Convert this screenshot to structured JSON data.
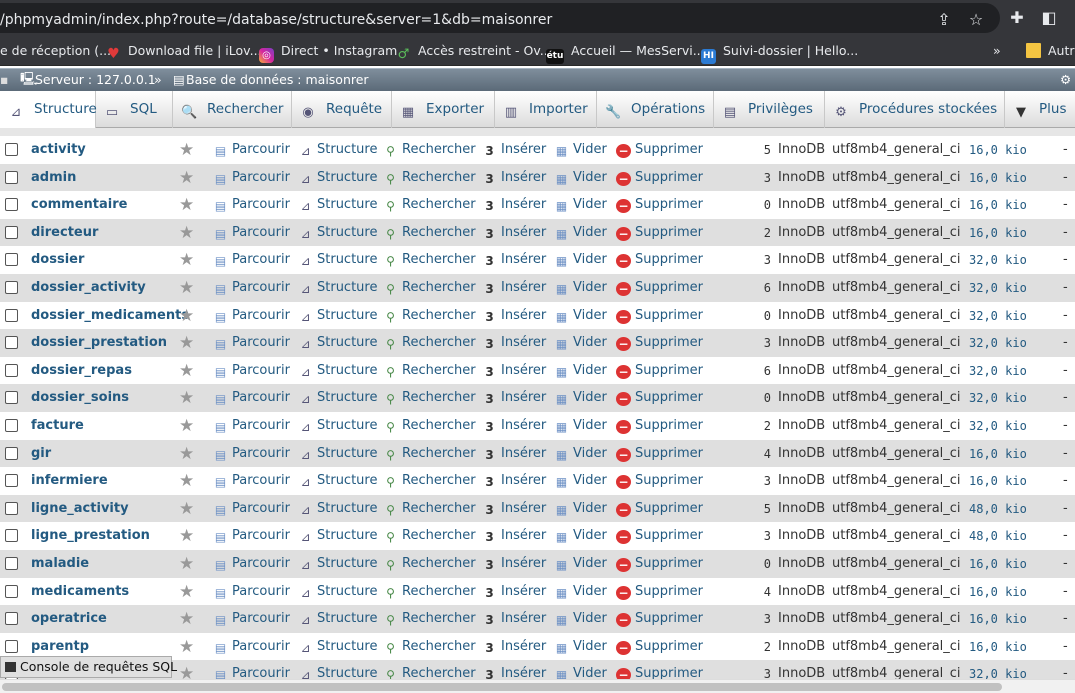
{
  "browser": {
    "url": "/phpmyadmin/index.php?route=/database/structure&server=1&db=maisonrer",
    "bookmarks": [
      {
        "label": "e de réception (...",
        "icon": "reception-icon",
        "color": "#2a6ebb"
      },
      {
        "label": "Download file | iLov...",
        "icon": "heart-icon",
        "color": "#e03a3a"
      },
      {
        "label": "Direct • Instagram",
        "icon": "instagram-icon",
        "color": "#d6249f"
      },
      {
        "label": "Accès restreint - Ov...",
        "icon": "leaf-icon",
        "color": "#3c9a3c"
      },
      {
        "label": "Accueil — MesServi...",
        "icon": "etu-icon",
        "color": "#111111"
      },
      {
        "label": "Suivi-dossier | Hello...",
        "icon": "hi-icon",
        "color": "#2b7bd4"
      }
    ],
    "more_label": "»",
    "other_label": "Autre"
  },
  "breadcrumb": {
    "server": "Serveur : 127.0.0.1",
    "separator": "»",
    "database": "Base de données : maisonrer"
  },
  "tabs": [
    {
      "label": "Structure",
      "icon": "structure-icon",
      "active": true
    },
    {
      "label": "SQL",
      "icon": "sql-icon"
    },
    {
      "label": "Rechercher",
      "icon": "search-icon"
    },
    {
      "label": "Requête",
      "icon": "query-icon"
    },
    {
      "label": "Exporter",
      "icon": "export-icon"
    },
    {
      "label": "Importer",
      "icon": "import-icon"
    },
    {
      "label": "Opérations",
      "icon": "wrench-icon"
    },
    {
      "label": "Privilèges",
      "icon": "privileges-icon"
    },
    {
      "label": "Procédures stockées",
      "icon": "routines-icon"
    },
    {
      "label": "Plus",
      "icon": "chevron-down-icon"
    }
  ],
  "actions": {
    "browse": "Parcourir",
    "structure": "Structure",
    "search": "Rechercher",
    "insert": "Insérer",
    "empty": "Vider",
    "drop": "Supprimer"
  },
  "tables": [
    {
      "name": "activity",
      "rows": "5",
      "engine": "InnoDB",
      "collation": "utf8mb4_general_ci",
      "size": "16,0 kio",
      "overhead": "-"
    },
    {
      "name": "admin",
      "rows": "3",
      "engine": "InnoDB",
      "collation": "utf8mb4_general_ci",
      "size": "16,0 kio",
      "overhead": "-"
    },
    {
      "name": "commentaire",
      "rows": "0",
      "engine": "InnoDB",
      "collation": "utf8mb4_general_ci",
      "size": "16,0 kio",
      "overhead": "-"
    },
    {
      "name": "directeur",
      "rows": "2",
      "engine": "InnoDB",
      "collation": "utf8mb4_general_ci",
      "size": "16,0 kio",
      "overhead": "-"
    },
    {
      "name": "dossier",
      "rows": "3",
      "engine": "InnoDB",
      "collation": "utf8mb4_general_ci",
      "size": "32,0 kio",
      "overhead": "-"
    },
    {
      "name": "dossier_activity",
      "rows": "6",
      "engine": "InnoDB",
      "collation": "utf8mb4_general_ci",
      "size": "32,0 kio",
      "overhead": "-"
    },
    {
      "name": "dossier_medicaments",
      "rows": "0",
      "engine": "InnoDB",
      "collation": "utf8mb4_general_ci",
      "size": "32,0 kio",
      "overhead": "-"
    },
    {
      "name": "dossier_prestation",
      "rows": "3",
      "engine": "InnoDB",
      "collation": "utf8mb4_general_ci",
      "size": "32,0 kio",
      "overhead": "-"
    },
    {
      "name": "dossier_repas",
      "rows": "6",
      "engine": "InnoDB",
      "collation": "utf8mb4_general_ci",
      "size": "32,0 kio",
      "overhead": "-"
    },
    {
      "name": "dossier_soins",
      "rows": "0",
      "engine": "InnoDB",
      "collation": "utf8mb4_general_ci",
      "size": "32,0 kio",
      "overhead": "-"
    },
    {
      "name": "facture",
      "rows": "2",
      "engine": "InnoDB",
      "collation": "utf8mb4_general_ci",
      "size": "32,0 kio",
      "overhead": "-"
    },
    {
      "name": "gir",
      "rows": "4",
      "engine": "InnoDB",
      "collation": "utf8mb4_general_ci",
      "size": "16,0 kio",
      "overhead": "-"
    },
    {
      "name": "infermiere",
      "rows": "3",
      "engine": "InnoDB",
      "collation": "utf8mb4_general_ci",
      "size": "16,0 kio",
      "overhead": "-"
    },
    {
      "name": "ligne_activity",
      "rows": "5",
      "engine": "InnoDB",
      "collation": "utf8mb4_general_ci",
      "size": "48,0 kio",
      "overhead": "-"
    },
    {
      "name": "ligne_prestation",
      "rows": "3",
      "engine": "InnoDB",
      "collation": "utf8mb4_general_ci",
      "size": "48,0 kio",
      "overhead": "-"
    },
    {
      "name": "maladie",
      "rows": "0",
      "engine": "InnoDB",
      "collation": "utf8mb4_general_ci",
      "size": "16,0 kio",
      "overhead": "-"
    },
    {
      "name": "medicaments",
      "rows": "4",
      "engine": "InnoDB",
      "collation": "utf8mb4_general_ci",
      "size": "16,0 kio",
      "overhead": "-"
    },
    {
      "name": "operatrice",
      "rows": "3",
      "engine": "InnoDB",
      "collation": "utf8mb4_general_ci",
      "size": "16,0 kio",
      "overhead": "-"
    },
    {
      "name": "parentp",
      "rows": "2",
      "engine": "InnoDB",
      "collation": "utf8mb4_general_ci",
      "size": "16,0 kio",
      "overhead": "-"
    },
    {
      "name": "",
      "rows": "3",
      "engine": "InnoDB",
      "collation": "utf8mb4_general_ci",
      "size": "32,0 kio",
      "overhead": "-"
    }
  ],
  "console": {
    "label": "Console de requêtes SQL"
  }
}
